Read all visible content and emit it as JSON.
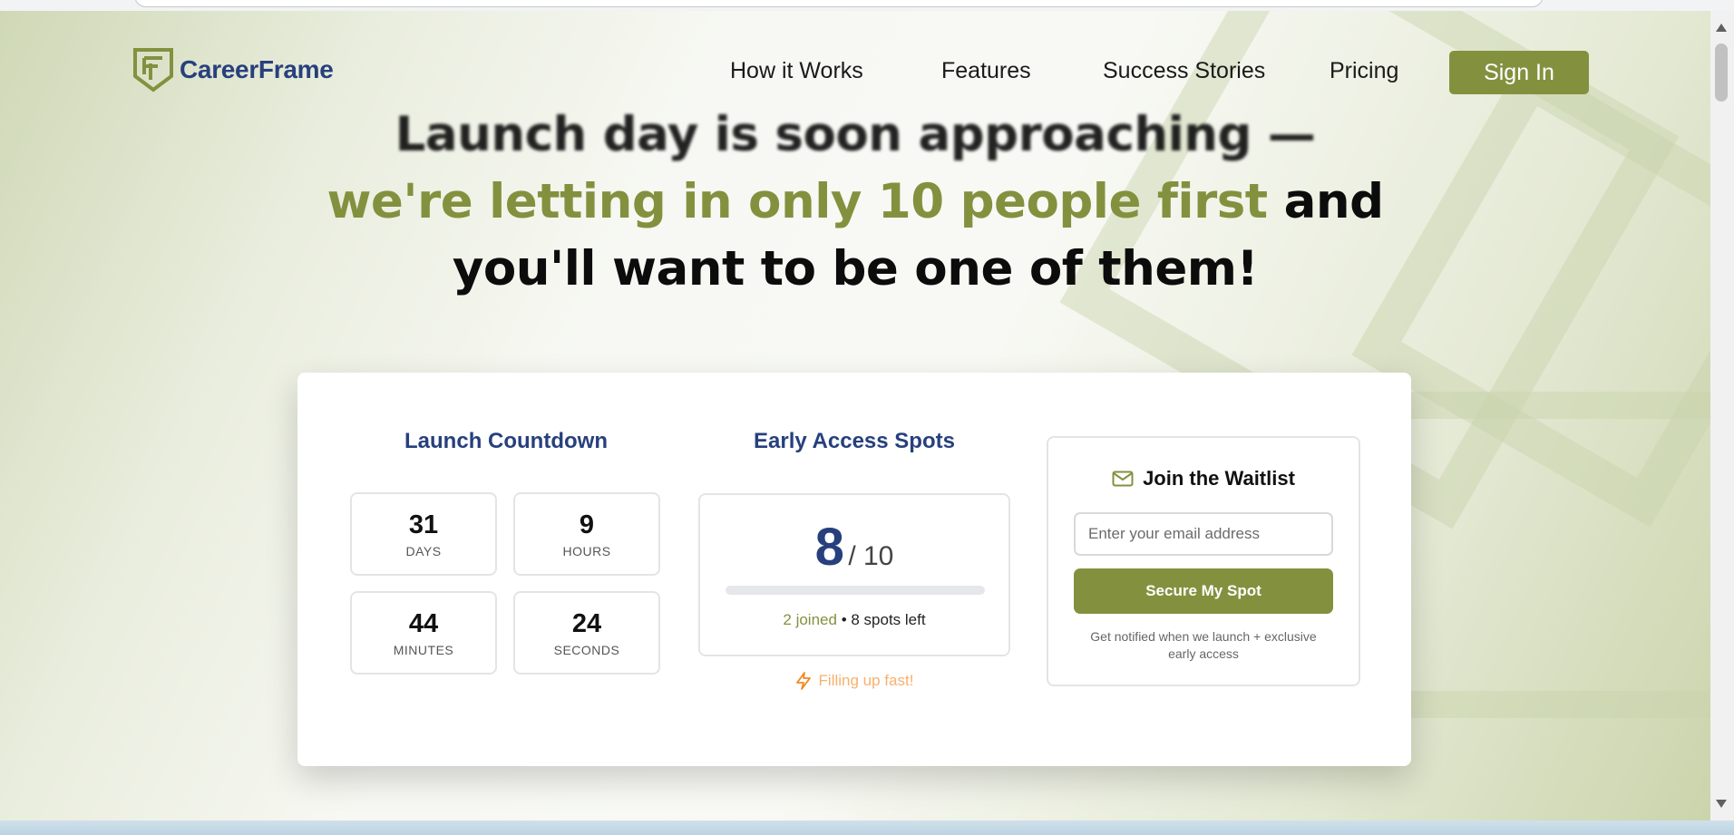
{
  "brand": {
    "name": "CareerFrame",
    "color": "#27407d",
    "accent": "#83913f"
  },
  "nav": {
    "items": [
      "How it Works",
      "Features",
      "Success Stories",
      "Pricing"
    ],
    "signin_label": "Sign In"
  },
  "hero": {
    "line1": "Launch day is soon approaching —",
    "line2_accent": "we're letting in only 10 people first",
    "line2_rest": " and",
    "line3": "you'll want to be one of them!"
  },
  "countdown": {
    "title": "Launch Countdown",
    "units": [
      {
        "value": "31",
        "label": "DAYS"
      },
      {
        "value": "9",
        "label": "HOURS"
      },
      {
        "value": "44",
        "label": "MINUTES"
      },
      {
        "value": "24",
        "label": "SECONDS"
      }
    ]
  },
  "spots": {
    "title": "Early Access Spots",
    "count": "8",
    "total": "/ 10",
    "progress_fraction": 0.0,
    "joined": "2 joined",
    "separator": "•",
    "left": "8 spots left",
    "urgency": "Filling up fast!",
    "urgency_icon": "lightning-icon",
    "urgency_color": "#f8b06e"
  },
  "waitlist": {
    "title": "Join the Waitlist",
    "icon": "mail-icon",
    "email_placeholder": "Enter your email address",
    "button_label": "Secure My Spot",
    "note": "Get notified when we launch + exclusive early access"
  }
}
